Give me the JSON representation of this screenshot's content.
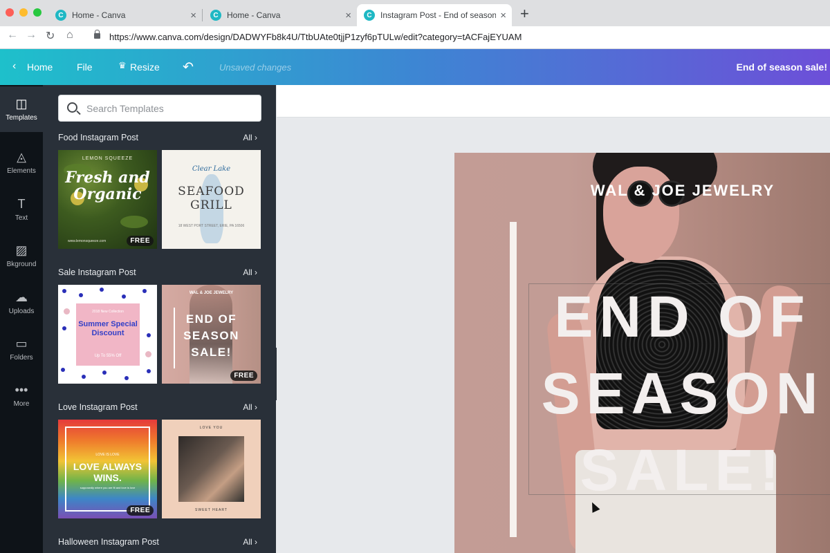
{
  "browser": {
    "tabs": [
      {
        "label": "Home - Canva",
        "favicon": "C"
      },
      {
        "label": "Home - Canva",
        "favicon": "C"
      },
      {
        "label": "Instagram Post - End of season sale!",
        "favicon": "C"
      }
    ],
    "url": "https://www.canva.com/design/DADWYFb8k4U/TtbUAte0tjjP1zyf6pTULw/edit?category=tACFajEYUAM"
  },
  "header": {
    "home": "Home",
    "file": "File",
    "resize": "Resize",
    "status": "Unsaved changes",
    "design_title": "End of season sale!"
  },
  "rail": [
    {
      "label": "Templates",
      "icon": "templates-icon"
    },
    {
      "label": "Elements",
      "icon": "elements-icon"
    },
    {
      "label": "Text",
      "icon": "text-icon"
    },
    {
      "label": "Bkground",
      "icon": "background-icon"
    },
    {
      "label": "Uploads",
      "icon": "uploads-icon"
    },
    {
      "label": "Folders",
      "icon": "folders-icon"
    },
    {
      "label": "More",
      "icon": "more-icon"
    }
  ],
  "search": {
    "placeholder": "Search Templates"
  },
  "sections": [
    {
      "title": "Food Instagram Post",
      "all": "All"
    },
    {
      "title": "Sale Instagram Post",
      "all": "All"
    },
    {
      "title": "Love Instagram Post",
      "all": "All"
    },
    {
      "title": "Halloween Instagram Post",
      "all": "All"
    }
  ],
  "badge": "FREE",
  "thumbs": {
    "food1": {
      "brand": "LEMON SQUEEZE",
      "title": "Fresh and Organic",
      "web": "www.lemonsqueeze.com"
    },
    "food2": {
      "script": "Clear Lake",
      "title": "SEAFOOD GRILL",
      "addr": "18 WEST PORT STREET, ERIE, PA 16506"
    },
    "sale1": {
      "small": "2018 New Collection",
      "title": "Summer Special Discount",
      "off": "Up To 55% Off"
    },
    "sale2": {
      "brand": "WAL & JOE JEWELRY",
      "title": "END OF SEASON SALE!"
    },
    "love1": {
      "small": "LOVE IS LOVE",
      "title": "LOVE ALWAYS WINS.",
      "sub": "supposedly where you are fit and love is love"
    },
    "love2": {
      "top": "LOVE YOU",
      "bottom": "SWEET HEART"
    }
  },
  "design": {
    "brand": "WAL & JOE JEWELRY",
    "headline": "END OF SEASON SALE!"
  },
  "colors": {
    "header_start": "#1ec0cb",
    "header_end": "#6d4fd8",
    "rail_bg": "#0e1318",
    "panel_bg": "#293039"
  }
}
